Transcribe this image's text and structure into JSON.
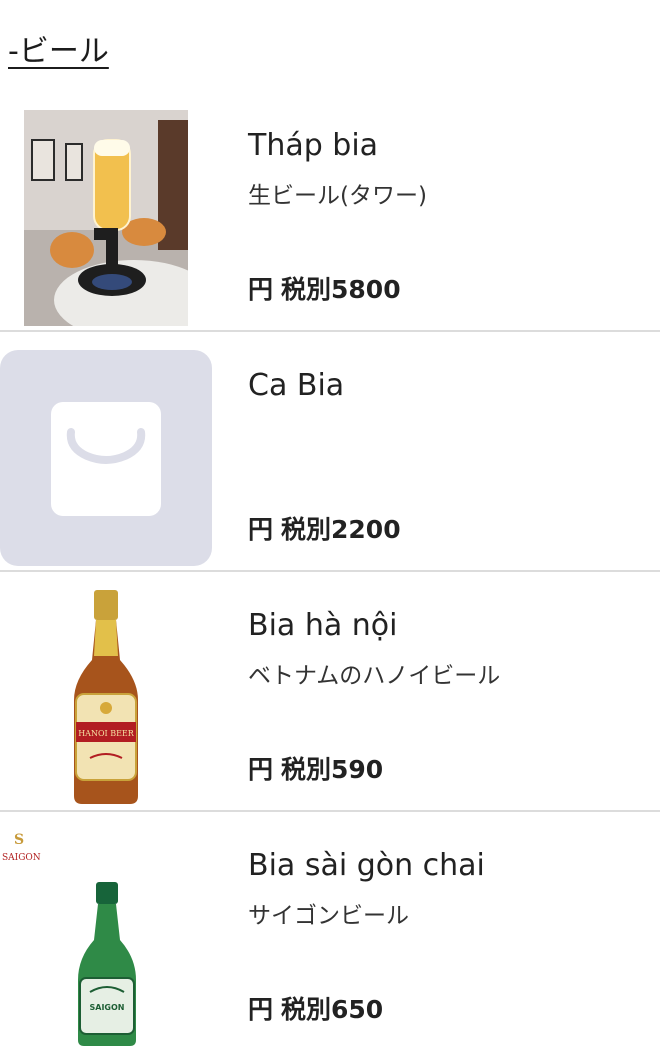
{
  "section": {
    "title": "-ビール"
  },
  "items": [
    {
      "name": "Tháp bia",
      "description": "生ビール(タワー)",
      "currency": "円",
      "price_label": "税別5800",
      "image": "beer-tower-photo"
    },
    {
      "name": "Ca Bia",
      "description": "",
      "currency": "円",
      "price_label": "税別2200",
      "image": "shopping-bag-placeholder-icon"
    },
    {
      "name": "Bia hà nội",
      "description": "ベトナムのハノイビール",
      "currency": "円",
      "price_label": "税別590",
      "image": "hanoi-beer-bottle",
      "label_text": "HANOI BEER"
    },
    {
      "name": "Bia sài gòn chai",
      "description": "サイゴンビール",
      "currency": "円",
      "price_label": "税別650",
      "image": "saigon-beer-bottle",
      "label_text": "SAIGON",
      "brand_logo_text": "SAIGON"
    }
  ]
}
